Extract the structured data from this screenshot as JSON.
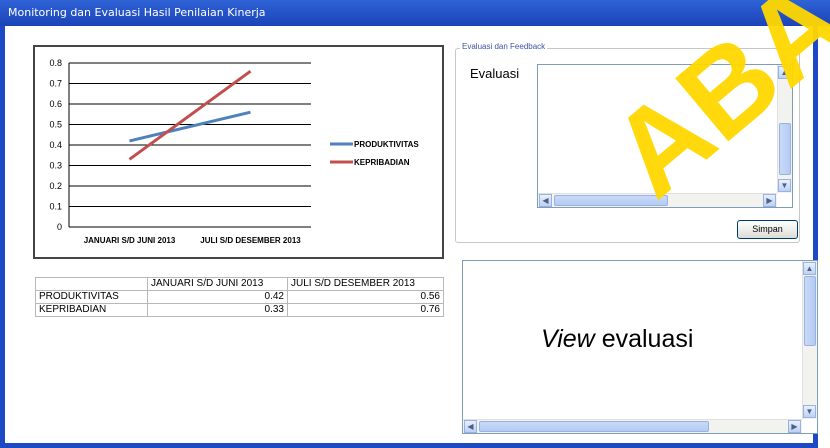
{
  "window": {
    "title": "Monitoring dan Evaluasi Hasil Penilaian Kinerja"
  },
  "chart_data": {
    "type": "line",
    "categories": [
      "JANUARI S/D JUNI 2013",
      "JULI S/D DESEMBER 2013"
    ],
    "series": [
      {
        "name": "PRODUKTIVITAS",
        "values": [
          0.42,
          0.56
        ],
        "color": "#4f81bd"
      },
      {
        "name": "KEPRIBADIAN",
        "values": [
          0.33,
          0.76
        ],
        "color": "#c0504d"
      }
    ],
    "ylim": [
      0,
      0.8
    ],
    "yticks": [
      "0",
      "0.1",
      "0.2",
      "0.3",
      "0.4",
      "0.5",
      "0.6",
      "0.7",
      "0.8"
    ],
    "grid": true,
    "legend": "right"
  },
  "table": {
    "headers": [
      "",
      "JANUARI S/D JUNI 2013",
      "JULI S/D DESEMBER 2013"
    ],
    "rows": [
      [
        "PRODUKTIVITAS",
        "0.42",
        "0.56"
      ],
      [
        "KEPRIBADIAN",
        "0.33",
        "0.76"
      ]
    ]
  },
  "feedback": {
    "group_title": "Evaluasi dan Feedback",
    "label": "Evaluasi",
    "value": "",
    "save_label": "Simpan"
  },
  "view": {
    "text_italic": "View",
    "text_rest": " evaluasi"
  },
  "watermark": "ABA"
}
